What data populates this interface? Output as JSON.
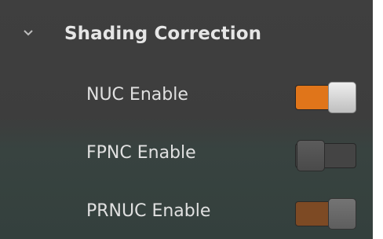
{
  "section": {
    "title": "Shading Correction",
    "expand_icon": "chevron-down-icon",
    "expanded": true
  },
  "settings": [
    {
      "label": "NUC Enable",
      "state": "on"
    },
    {
      "label": "FPNC Enable",
      "state": "off"
    },
    {
      "label": "PRNUC Enable",
      "state": "on-disabled"
    }
  ],
  "colors": {
    "panel_background": "#3f3f3f",
    "toggle_on": "#e0751a",
    "toggle_on_disabled": "#7d4a24",
    "toggle_off": "#444444"
  }
}
